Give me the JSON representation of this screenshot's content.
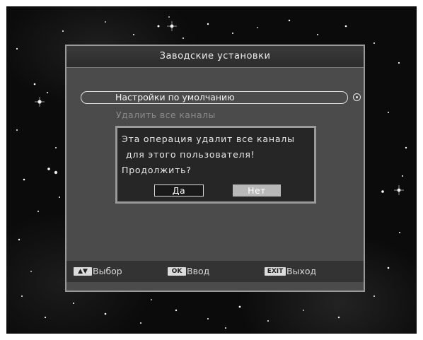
{
  "dialog_window": {
    "title": "Заводские установки",
    "menu": {
      "selected_item": "Настройки по умолчанию",
      "dim_item": "Удалить все каналы"
    }
  },
  "confirm": {
    "line1": "Эта операция удалит все каналы",
    "line2": "для этого пользователя!",
    "line3": "Продолжить?",
    "yes_label": "Да",
    "no_label": "Нет"
  },
  "footer": {
    "select_key": "▲▼",
    "select_label": "Выбор",
    "ok_key": "OK",
    "ok_label": "Ввод",
    "exit_key": "EXIT",
    "exit_label": "Выход"
  },
  "colors": {
    "panel_bg": "#4b4b4b",
    "dialog_bg": "#262626",
    "highlight_button": "#b8b8b8",
    "text": "#e8e8e8"
  }
}
